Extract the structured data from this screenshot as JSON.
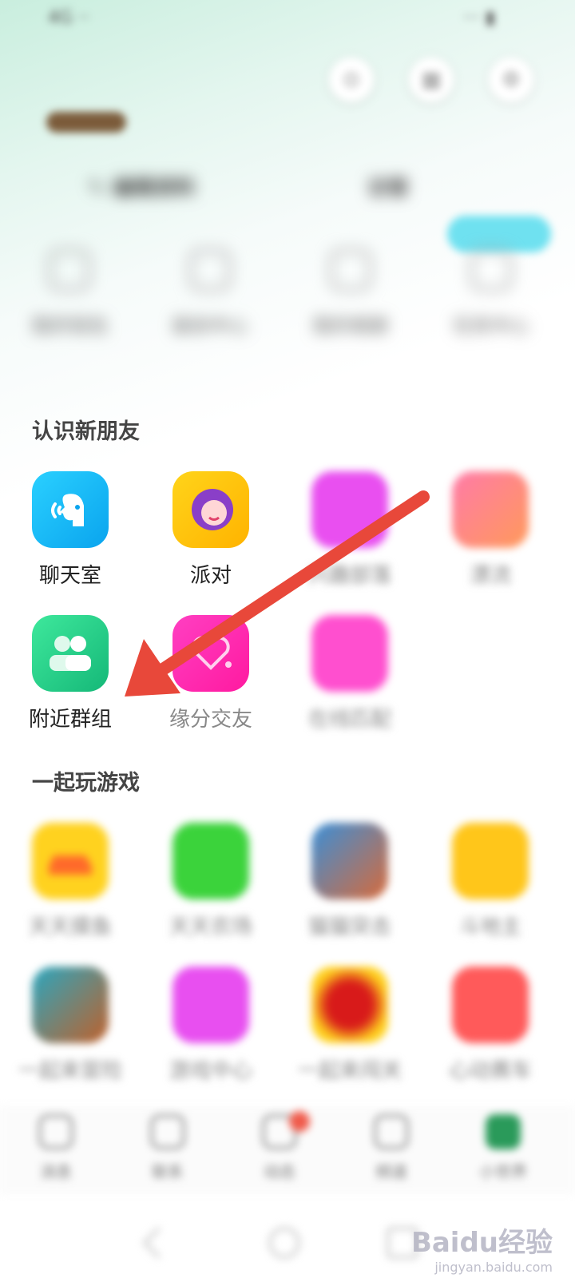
{
  "status": {
    "left": "4G ·· ",
    "right": "··· ▮"
  },
  "top_icons": [
    "scan-icon",
    "calendar-icon",
    "settings-icon"
  ],
  "quick_items": [
    {
      "label": "我的钱包"
    },
    {
      "label": "装扮中心"
    },
    {
      "label": "我的相册"
    },
    {
      "label": "任务中心"
    }
  ],
  "profile_links": {
    "edit": "✎ 编辑资料",
    "visitors": "访客"
  },
  "sections": {
    "meet": {
      "title": "认识新朋友"
    },
    "games": {
      "title": "一起玩游戏"
    }
  },
  "meet_apps": [
    {
      "label": "聊天室",
      "color": "#1ab8f0",
      "blur": false
    },
    {
      "label": "派对",
      "color": "#ffcc1a",
      "blur": false
    },
    {
      "label": "兴趣部落",
      "color": "#e94ff0",
      "blur": true
    },
    {
      "label": "漂流",
      "color": "#ff6aa0",
      "blur": true
    },
    {
      "label": "附近群组",
      "color": "#2ec88a",
      "blur": false
    },
    {
      "label": "缘分交友",
      "color": "#ff2ab0",
      "blur": false
    },
    {
      "label": "在线匹配",
      "color": "#ff4fcf",
      "blur": true
    }
  ],
  "game_apps": [
    {
      "label": "天天摸鱼",
      "color": "#ffd21f"
    },
    {
      "label": "天天农场",
      "color": "#3bd33b"
    },
    {
      "label": "猫猫突击",
      "color": "#3a8fd8"
    },
    {
      "label": "斗地主",
      "color": "#ffc61a"
    },
    {
      "label": "一起来冒险",
      "color": "#2aa7c0"
    },
    {
      "label": "游戏中心",
      "color": "#e84ff0"
    },
    {
      "label": "一起来闯关",
      "color": "#ffd21f"
    },
    {
      "label": "心动赛车",
      "color": "#ff5a5a"
    }
  ],
  "bottom_nav": [
    {
      "label": "消息"
    },
    {
      "label": "联系"
    },
    {
      "label": "动态"
    },
    {
      "label": "频道"
    },
    {
      "label": "小世界"
    }
  ],
  "watermark": {
    "main": "Baidu经验",
    "sub": "jingyan.baidu.com"
  },
  "colors": {
    "arrow": "#e8483a",
    "accent": "#1ab8f0"
  }
}
